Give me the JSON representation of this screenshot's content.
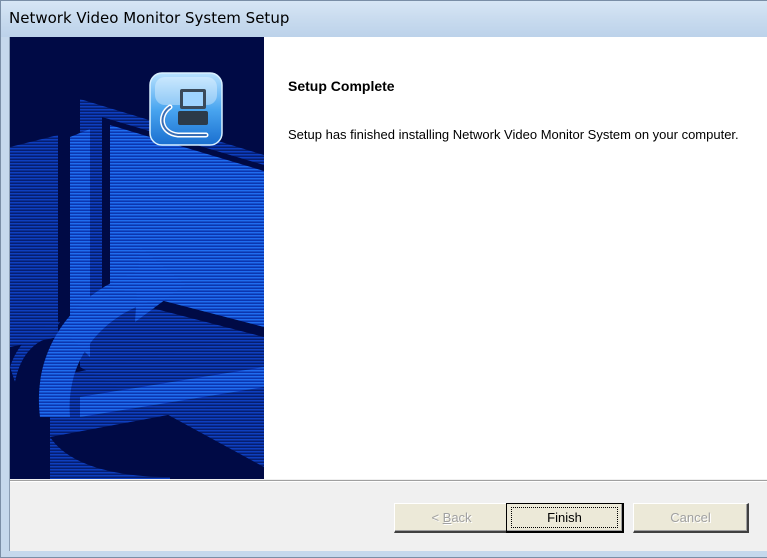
{
  "window": {
    "title": "Network Video Monitor System Setup"
  },
  "content": {
    "heading": "Setup Complete",
    "message": "Setup has finished installing Network Video Monitor System on your computer."
  },
  "buttons": {
    "back": {
      "prefix": "< ",
      "mnemonic": "B",
      "rest": "ack",
      "enabled": false
    },
    "finish": {
      "label": "Finish",
      "enabled": true,
      "focused": true
    },
    "cancel": {
      "label": "Cancel",
      "enabled": false
    }
  },
  "banner": {
    "icon": "computer-setup-icon",
    "background_color": "#000a45",
    "accent_color": "#1e6ef5"
  }
}
